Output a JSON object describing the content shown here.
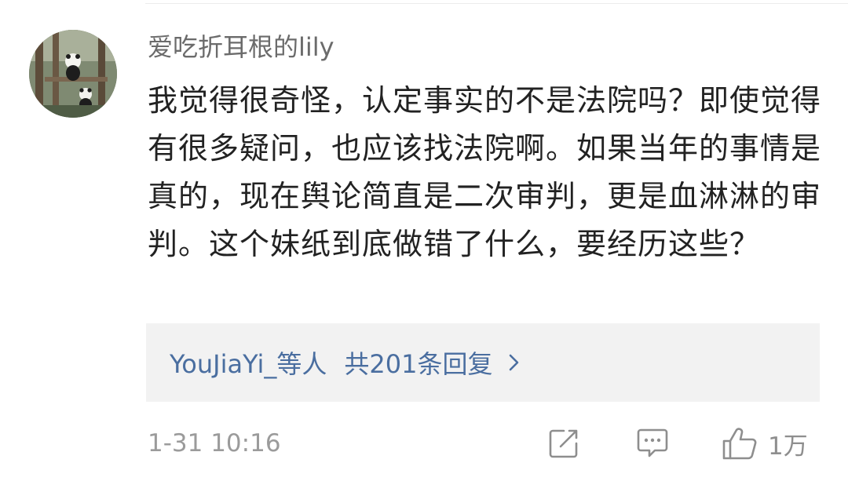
{
  "comment": {
    "username": "爱吃折耳根的lily",
    "text": "我觉得很奇怪，认定事实的不是法院吗？即使觉得有很多疑问，也应该找法院啊。如果当年的事情是真的，现在舆论简直是二次审判，更是血淋淋的审判。这个妹纸到底做错了什么，要经历这些？",
    "avatar_icon": "panda-photo-avatar"
  },
  "replies": {
    "users_label": "YouJiaYi_等人",
    "count_label": "共201条回复",
    "chevron_icon": "chevron-right-icon",
    "link_color": "#4a6ea0"
  },
  "footer": {
    "timestamp": "1-31 10:16",
    "forward_icon": "share-edit-icon",
    "reply_icon": "comment-bubble-icon",
    "like_icon": "thumbs-up-icon",
    "like_count": "1万"
  }
}
